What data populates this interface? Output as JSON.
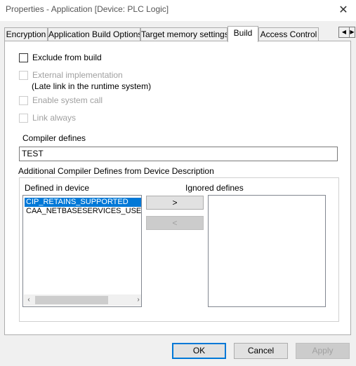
{
  "window": {
    "title": "Properties - Application [Device: PLC Logic]"
  },
  "tabs": [
    {
      "label": "Encryption"
    },
    {
      "label": "Application Build Options"
    },
    {
      "label": "Target memory settings"
    },
    {
      "label": "Build",
      "active": true
    },
    {
      "label": "Access Control"
    }
  ],
  "options": {
    "exclude_from_build": {
      "label": "Exclude from build",
      "checked": false,
      "enabled": true
    },
    "external_implementation": {
      "label": "External implementation",
      "sublabel": "(Late link in the runtime system)",
      "checked": false,
      "enabled": false
    },
    "enable_system_call": {
      "label": "Enable system call",
      "checked": false,
      "enabled": false
    },
    "link_always": {
      "label": "Link always",
      "checked": false,
      "enabled": false
    }
  },
  "compiler_defines": {
    "label": "Compiler defines",
    "value": "TEST"
  },
  "device_defines": {
    "group_title": "Additional Compiler Defines from Device Description",
    "defined_label": "Defined in device",
    "ignored_label": "Ignored defines",
    "defined_items": [
      "CIP_RETAINS_SUPPORTED",
      "CAA_NETBASESERVICES_USE_AS"
    ],
    "selected_index": 0,
    "ignored_items": [],
    "move_right_label": ">",
    "move_left_label": "<"
  },
  "footer": {
    "ok_label": "OK",
    "cancel_label": "Cancel",
    "apply_label": "Apply"
  },
  "colors": {
    "selection": "#0078d7",
    "default_button_border": "#0078d7"
  }
}
